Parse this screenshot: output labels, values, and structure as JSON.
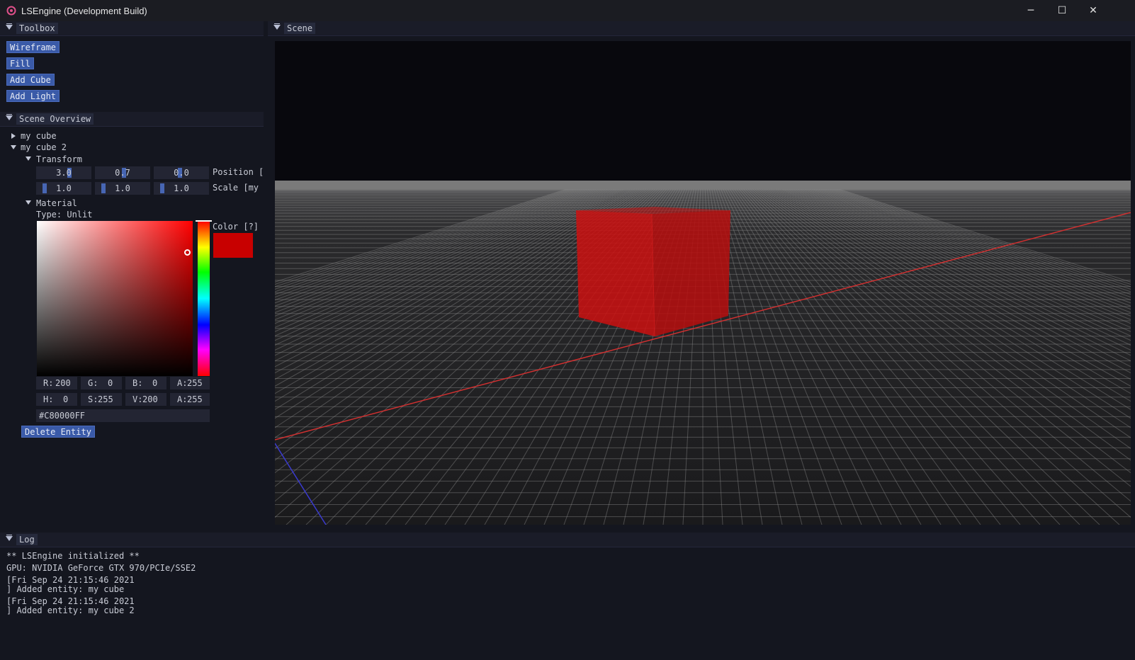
{
  "window": {
    "title": "LSEngine (Development Build)",
    "minimize_glyph": "─",
    "maximize_glyph": "☐",
    "close_glyph": "✕",
    "icon": "app-logo-icon"
  },
  "toolbox": {
    "title": "Toolbox",
    "buttons": [
      "Wireframe",
      "Fill",
      "Add Cube",
      "Add Light"
    ]
  },
  "scene_overview": {
    "title": "Scene Overview",
    "entities": [
      "my cube",
      "my cube 2"
    ],
    "transform_label": "Transform",
    "position": {
      "values": [
        "3.0",
        "0.7",
        "0.0"
      ],
      "label": "Position [n"
    },
    "scale": {
      "values": [
        "1.0",
        "1.0",
        "1.0"
      ],
      "label": "Scale [my c"
    },
    "material_label": "Material",
    "material_type": "Type: Unlit",
    "color_label": "Color [?]",
    "color_hex_swatch": "#c80000",
    "rgba": {
      "r_label": "R:",
      "r": "200",
      "g_label": "G:",
      "g": "0",
      "b_label": "B:",
      "b": "0",
      "a_label": "A:",
      "a": "255"
    },
    "hsva": {
      "h_label": "H:",
      "h": "0",
      "s_label": "S:",
      "s": "255",
      "v_label": "V:",
      "v": "200",
      "a_label": "A:",
      "a": "255"
    },
    "hex_value": "#C80000FF",
    "delete_button": "Delete Entity"
  },
  "scene": {
    "title": "Scene",
    "sky_color": "#08080d",
    "ground_color": "#1e1e20",
    "horizon_color": "#7a7a7a",
    "cube_color": "#cc1010",
    "x_axis_color": "#d23030",
    "z_axis_color": "#3a3ad0"
  },
  "log": {
    "title": "Log",
    "lines": [
      "** LSEngine initialized **",
      "GPU: NVIDIA GeForce GTX 970/PCIe/SSE2",
      "[Fri Sep 24 21:15:46 2021",
      "] Added entity: my cube",
      "[Fri Sep 24 21:15:46 2021",
      "] Added entity: my cube 2"
    ]
  }
}
